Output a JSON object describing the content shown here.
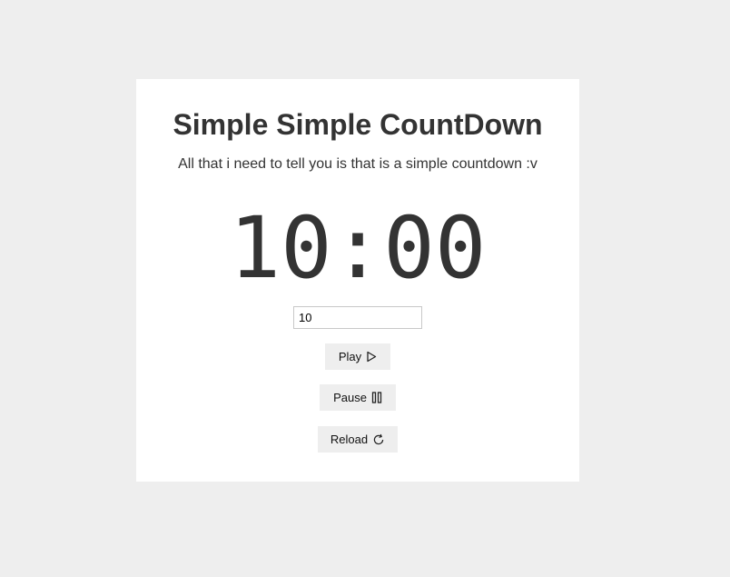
{
  "header": {
    "title": "Simple Simple CountDown",
    "subtitle": "All that i need to tell you is that is a simple countdown :v"
  },
  "timer": {
    "display": "10:00"
  },
  "minutes_input": {
    "value": "10"
  },
  "controls": {
    "play_label": "Play",
    "pause_label": "Pause",
    "reload_label": "Reload"
  },
  "icons": {
    "play": "play-icon",
    "pause": "pause-icon",
    "reload": "reload-icon"
  },
  "colors": {
    "page_background": "#eeeeee",
    "card_background": "#ffffff",
    "text": "#333333",
    "button_background": "#eeeeee"
  }
}
